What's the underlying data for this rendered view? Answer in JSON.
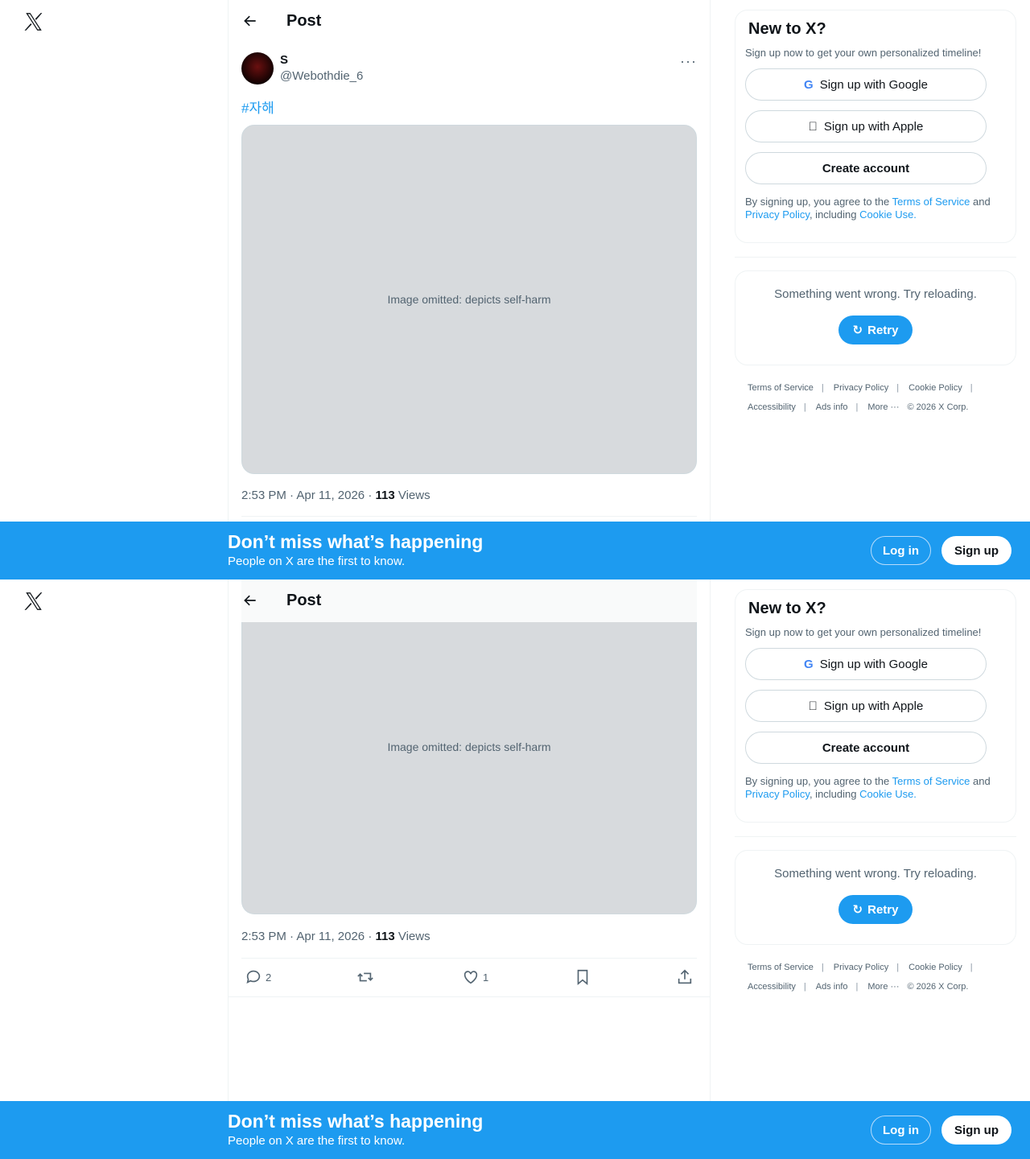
{
  "nav": {
    "logo": "x-logo-icon"
  },
  "header": {
    "title": "Post",
    "back_icon": "arrow-left-icon"
  },
  "post": {
    "display_name": "S",
    "handle": "@Webothdie_6",
    "hashtag": "#자해",
    "media_notice": "Image omitted: depicts self-harm",
    "time": "2:53 PM · Apr 11, 2026 · ",
    "views_count": "113",
    "views_label": " Views",
    "replies": "2",
    "reposts": "",
    "likes": "1"
  },
  "signup": {
    "title": "New to X?",
    "subtitle": "Sign up now to get your own personalized timeline!",
    "google": "Sign up with Google",
    "apple": "Sign up with Apple",
    "create": "Create account",
    "terms_pre": "By signing up, you agree to the ",
    "terms_link": "Terms of Service",
    "terms_mid": " and ",
    "privacy_link": "Privacy Policy",
    "terms_mid2": ", including ",
    "cookie_link": "Cookie Use."
  },
  "error": {
    "message": "Something went wrong. Try reloading.",
    "retry": "Retry"
  },
  "footer": {
    "terms": "Terms of Service",
    "privacy": "Privacy Policy",
    "cookie": "Cookie Policy",
    "accessibility": "Accessibility",
    "ads": "Ads info",
    "more": "More ···",
    "copyright": "© 2026 X Corp."
  },
  "banner": {
    "title": "Don’t miss what’s happening",
    "subtitle": "People on X are the first to know.",
    "login": "Log in",
    "signup": "Sign up"
  },
  "colors": {
    "accent": "#1d9bf0",
    "text": "#0f1419",
    "secondary": "#536471"
  }
}
